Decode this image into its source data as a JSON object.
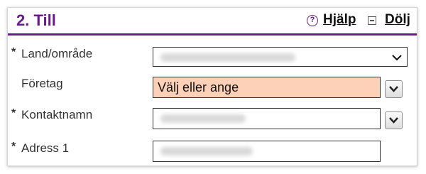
{
  "section": {
    "title": "2. Till",
    "help_label": "Hjälp",
    "hide_label": "Dölj",
    "help_icon_glyph": "?"
  },
  "colors": {
    "accent": "#6a1b8a",
    "highlight_field": "#fcd1b7"
  },
  "fields": {
    "country": {
      "label": "Land/område",
      "required": true,
      "marker": "*",
      "value_obscured": true
    },
    "company": {
      "label": "Företag",
      "required": false,
      "value": "Välj eller ange"
    },
    "contact": {
      "label": "Kontaktnamn",
      "required": true,
      "marker": "*",
      "value_obscured": true
    },
    "address1": {
      "label": "Adress 1",
      "required": true,
      "marker": "*",
      "value_obscured": true
    }
  },
  "icons": {
    "help": "question-circle-icon",
    "hide": "collapse-square-icon",
    "select_arrow": "chevron-down-icon",
    "dropdown_button": "chevron-down-icon"
  }
}
